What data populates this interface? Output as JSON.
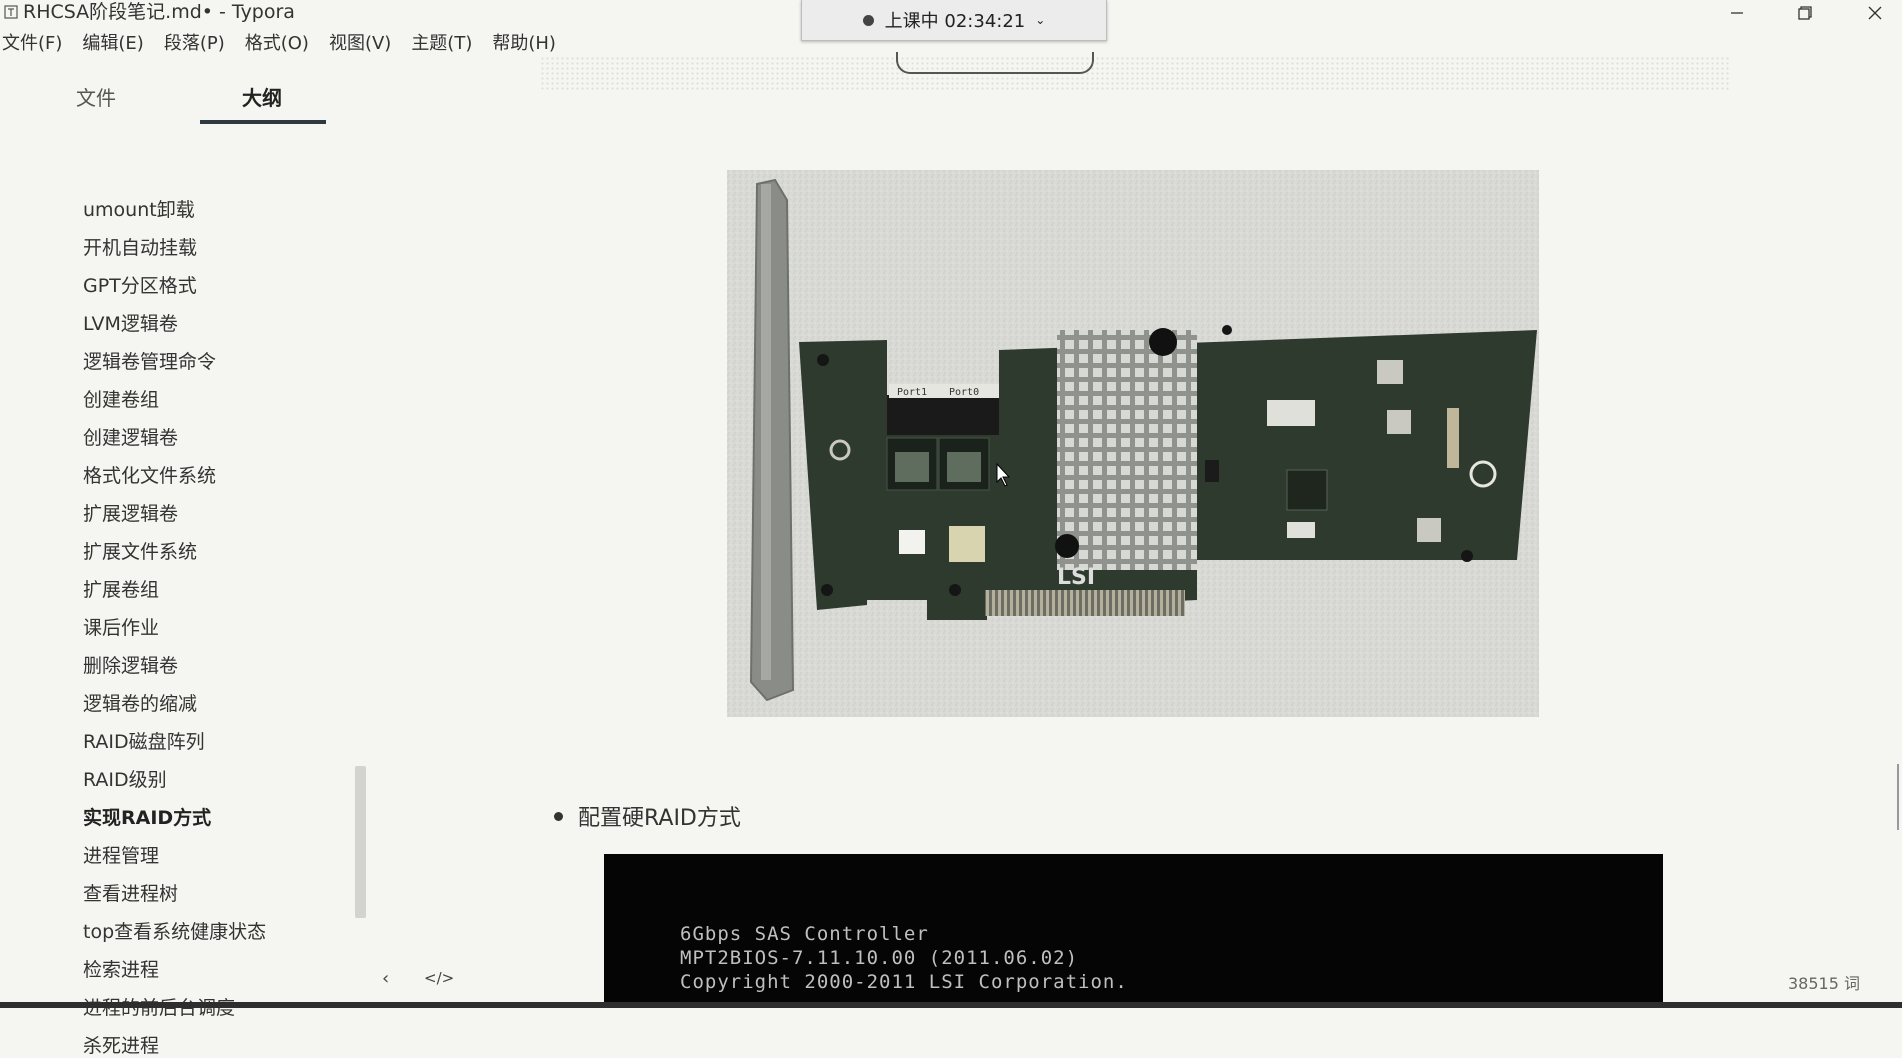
{
  "window": {
    "title": "RHCSA阶段笔记.md• - Typora"
  },
  "menu": [
    "文件(F)",
    "编辑(E)",
    "段落(P)",
    "格式(O)",
    "视图(V)",
    "主题(T)",
    "帮助(H)"
  ],
  "class_indicator": {
    "text": "上课中 02:34:21"
  },
  "sidebar": {
    "tabs": [
      "文件",
      "大纲"
    ],
    "active_tab": "大纲",
    "outline": [
      "umount卸载",
      "开机自动挂载",
      "GPT分区格式",
      "LVM逻辑卷",
      "逻辑卷管理命令",
      "创建卷组",
      "创建逻辑卷",
      "格式化文件系统",
      "扩展逻辑卷",
      "扩展文件系统",
      "扩展卷组",
      "课后作业",
      "删除逻辑卷",
      "逻辑卷的缩减",
      "RAID磁盘阵列",
      "RAID级别",
      "实现RAID方式",
      "进程管理",
      "查看进程树",
      "top查看系统健康状态",
      "检索进程",
      "进程的前后台调度",
      "杀死进程"
    ],
    "active_item": "实现RAID方式",
    "footer": {
      "back_icon": "chevron-left-icon",
      "code_icon": "source-code-icon",
      "code_label": "</>"
    }
  },
  "content": {
    "image_alt": "LSI RAID controller card",
    "card_labels": [
      "Port1",
      "Port0",
      "LSI"
    ],
    "bullet": "配置硬RAID方式",
    "bios_lines": [
      "6Gbps SAS Controller",
      "MPT2BIOS-7.11.10.00 (2011.06.02)",
      "Copyright 2000-2011 LSI Corporation."
    ]
  },
  "status": {
    "word_count": "38515 词"
  },
  "colors": {
    "background": "#f5f6f1",
    "text": "#333333",
    "tab_underline": "#2f3a40",
    "terminal_bg": "#050505",
    "pcb_green": "#2e3a2e"
  }
}
